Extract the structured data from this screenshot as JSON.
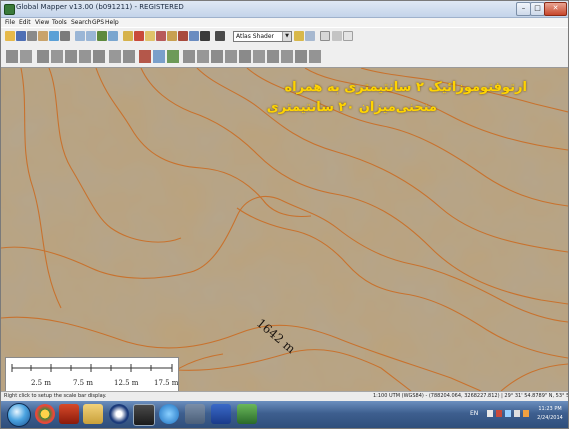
{
  "window": {
    "title": "Global Mapper v13.00 (b091211) - REGISTERED",
    "controls": {
      "minimize": "–",
      "maximize": "□",
      "close": "✕"
    }
  },
  "menubar": {
    "items": [
      "File",
      "Edit",
      "View",
      "Tools",
      "Search",
      "GPS",
      "Help"
    ]
  },
  "toolbar": {
    "shader_select": {
      "value": "Atlas Shader",
      "arrow": "▼"
    },
    "icons": [
      "open-icon",
      "save-icon",
      "print-icon",
      "config-icon",
      "overlay-icon",
      "pan-icon",
      "zoom-in-icon",
      "zoom-out-icon",
      "full-view-icon",
      "measure-icon",
      "3d-view-icon",
      "path-profile-icon",
      "line-icon",
      "area-icon",
      "digitizer-icon",
      "feature-info-icon",
      "shader-icon",
      "lighting-icon",
      "vertical-exaggeration-icon",
      "water-level-icon"
    ]
  },
  "map": {
    "overlay_line1": "ارتوفتوموزائیک ۲ سانتیمتری به همراه",
    "overlay_line2": "منحنی‌میزان ۲۰ سانتیمتری",
    "contour_label": "1642 m",
    "scale_labels": [
      "2.5 m",
      "7.5 m",
      "12.5 m",
      "17.5 m"
    ]
  },
  "statusbar": {
    "hint": "Right click to setup the scale bar display.",
    "coords": "1:100  UTM (WGS84) - (788204.064, 3268227.812) | 29° 31' 54.8789\" N, 53° 58' 54.0239\" E"
  },
  "taskbar": {
    "apps": [
      "explorer",
      "chrome",
      "media",
      "files",
      "media-player",
      "browser",
      "ie",
      "word",
      "gis"
    ],
    "tray": {
      "lang": "EN",
      "time": "11:23 PM",
      "date": "2/24/2014"
    }
  },
  "colors": {
    "contour": "#c9702a",
    "overlay_text": "#ffd400",
    "titlebar": "#c4d4ea",
    "taskbar": "#3e5f8f"
  }
}
